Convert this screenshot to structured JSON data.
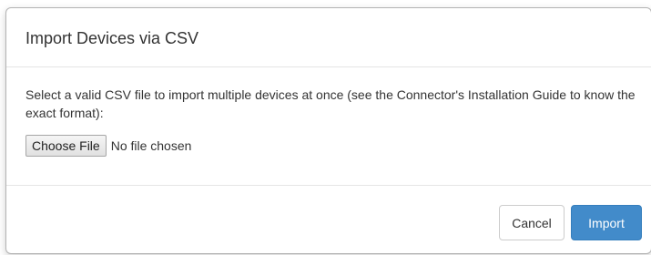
{
  "dialog": {
    "title": "Import Devices via CSV",
    "description": "Select a valid CSV file to import multiple devices at once (see the Connector's Installation Guide to know the exact format):",
    "file_input": {
      "button_label": "Choose File",
      "status": "No file chosen"
    },
    "footer": {
      "cancel_label": "Cancel",
      "import_label": "Import"
    }
  },
  "colors": {
    "primary": "#428bca",
    "border": "#e5e5e5"
  }
}
